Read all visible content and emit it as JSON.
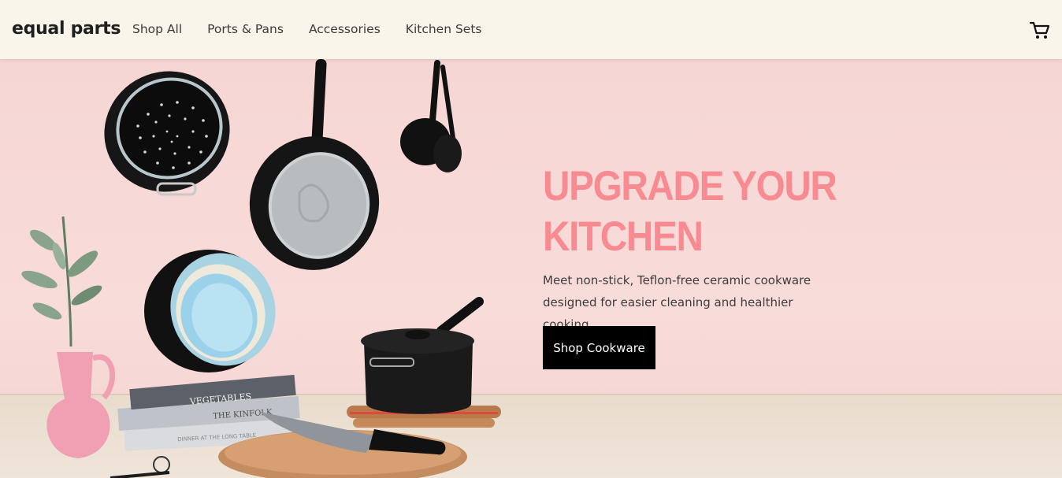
{
  "brand": {
    "name": "equal parts"
  },
  "nav": {
    "links": [
      {
        "label": "Shop All"
      },
      {
        "label": "Ports & Pans"
      },
      {
        "label": "Accessories"
      },
      {
        "label": "Kitchen Sets"
      }
    ],
    "cart_icon": "shopping-cart-icon"
  },
  "hero": {
    "title": "UPGRADE YOUR KITCHEN",
    "subtitle": "Meet non-stick, Teflon-free ceramic cookware designed for easier cleaning and healthier cooking.",
    "cta_label": "Shop Cookware",
    "accent_color": "#f88b91",
    "image": {
      "book_titles": [
        "VEGETABLES",
        "THE KINFOLK",
        "DINNER AT THE LONG TABLE"
      ]
    }
  }
}
